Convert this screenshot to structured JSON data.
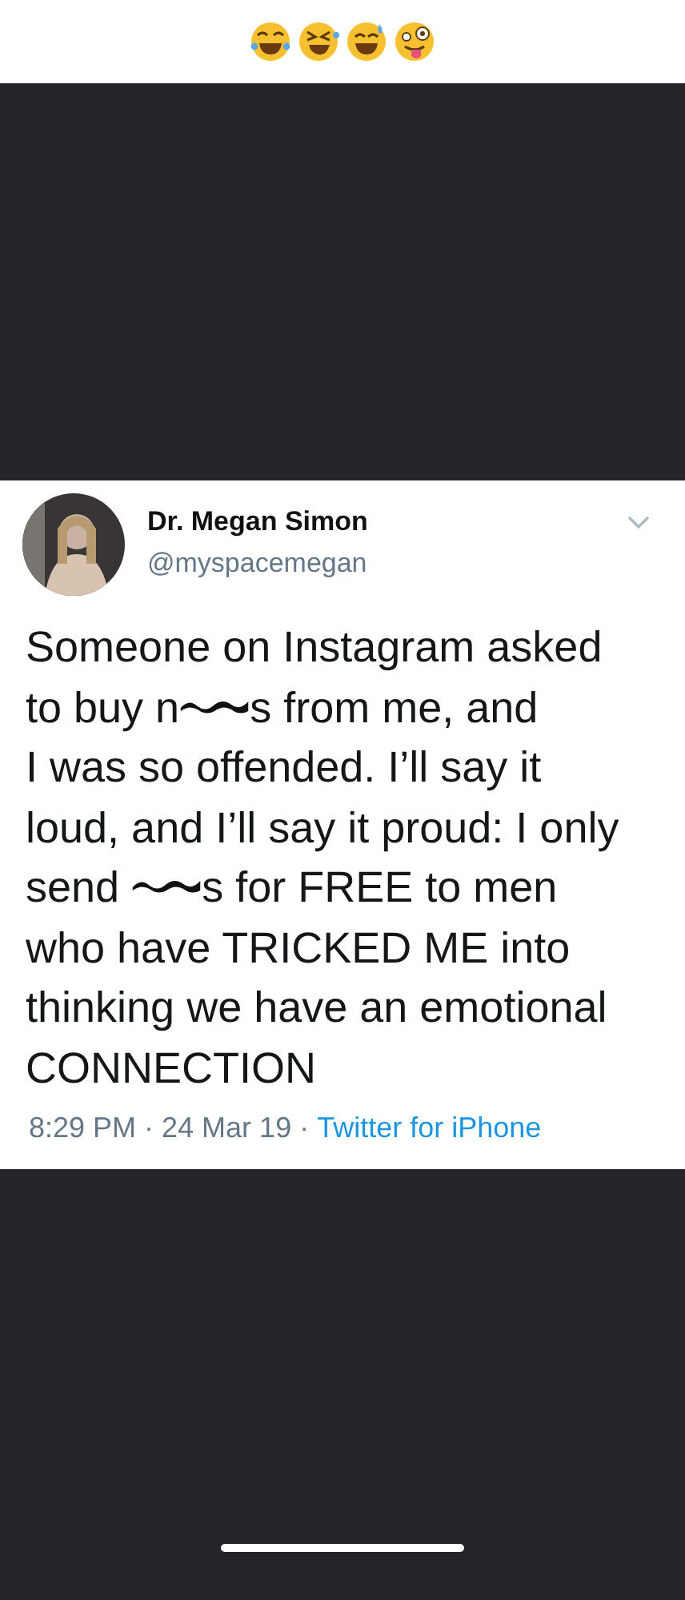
{
  "caption": {
    "emojis": [
      {
        "kind": "tears_of_joy"
      },
      {
        "kind": "rolling_laughing"
      },
      {
        "kind": "sweat_smile"
      },
      {
        "kind": "zany"
      }
    ]
  },
  "tweet": {
    "name": "Dr. Megan Simon",
    "handle": "@myspacemegan",
    "lines": [
      [
        {
          "kind": "text",
          "text": "Someone on Instagram asked"
        }
      ],
      [
        {
          "kind": "text",
          "text": "to buy n"
        },
        {
          "kind": "scribble"
        },
        {
          "kind": "text",
          "text": "s from me, and"
        }
      ],
      [
        {
          "kind": "text",
          "text": "I was so offended. I’ll say it"
        }
      ],
      [
        {
          "kind": "text",
          "text": "loud, and I’ll say it proud: I only"
        }
      ],
      [
        {
          "kind": "text",
          "text": "send "
        },
        {
          "kind": "scribble"
        },
        {
          "kind": "text",
          "text": "s for FREE to men"
        }
      ],
      [
        {
          "kind": "text",
          "text": "who have TRICKED ME into"
        }
      ],
      [
        {
          "kind": "text",
          "text": "thinking we have an emotional"
        }
      ],
      [
        {
          "kind": "text",
          "text": "CONNECTION"
        }
      ]
    ],
    "time": "8:29 PM · 24 Mar 19 · ",
    "source": "Twitter for iPhone"
  }
}
